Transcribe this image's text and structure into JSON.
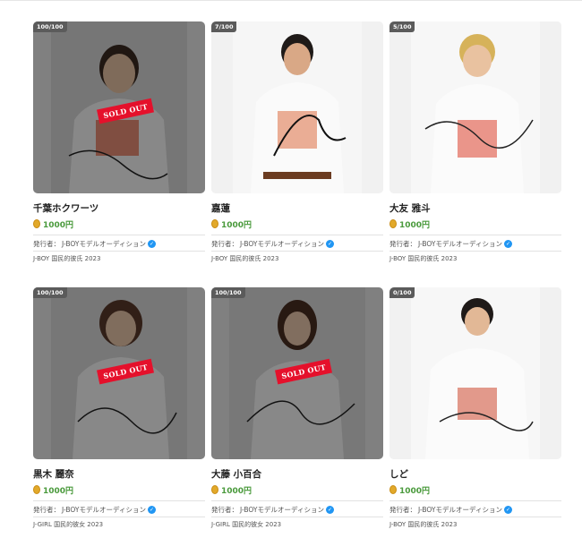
{
  "cards": [
    {
      "stock": "100/100",
      "name": "千葉ホクワーツ",
      "price": "1000円",
      "publisher_label": "発行者：",
      "publisher": "J-BOYモデルオーディション",
      "category": "J-BOY 国民的彼氏 2023",
      "sold_out": true,
      "sold_label": "SOLD OUT",
      "signature": "千葉ホクワーツ"
    },
    {
      "stock": "7/100",
      "name": "嘉蓮",
      "price": "1000円",
      "publisher_label": "発行者：",
      "publisher": "J-BOYモデルオーディション",
      "category": "J-BOY 国民的彼氏 2023",
      "sold_out": false,
      "sold_label": "",
      "signature": "Jin"
    },
    {
      "stock": "5/100",
      "name": "大友 雅斗",
      "price": "1000円",
      "publisher_label": "発行者：",
      "publisher": "J-BOYモデルオーディション",
      "category": "J-BOY 国民的彼氏 2023",
      "sold_out": false,
      "sold_label": "",
      "signature": "Masato"
    },
    {
      "stock": "100/100",
      "name": "黒木 麗奈",
      "price": "1000円",
      "publisher_label": "発行者：",
      "publisher": "J-BOYモデルオーディション",
      "category": "J-GIRL 国民的彼女 2023",
      "sold_out": true,
      "sold_label": "SOLD OUT",
      "signature": "Rena"
    },
    {
      "stock": "100/100",
      "name": "大藤 小百合",
      "price": "1000円",
      "publisher_label": "発行者：",
      "publisher": "J-BOYモデルオーディション",
      "category": "J-GIRL 国民的彼女 2023",
      "sold_out": true,
      "sold_label": "SOLD OUT",
      "signature": "Sayuri"
    },
    {
      "stock": "0/100",
      "name": "しど",
      "price": "1000円",
      "publisher_label": "発行者：",
      "publisher": "J-BOYモデルオーディション",
      "category": "J-BOY 国民的彼氏 2023",
      "sold_out": false,
      "sold_label": "",
      "signature": "Shido"
    }
  ],
  "colors": {
    "sold_out": "#e5102b",
    "price": "#4a9a3c",
    "verified": "#2196f3",
    "coin": "#e2a92a"
  }
}
